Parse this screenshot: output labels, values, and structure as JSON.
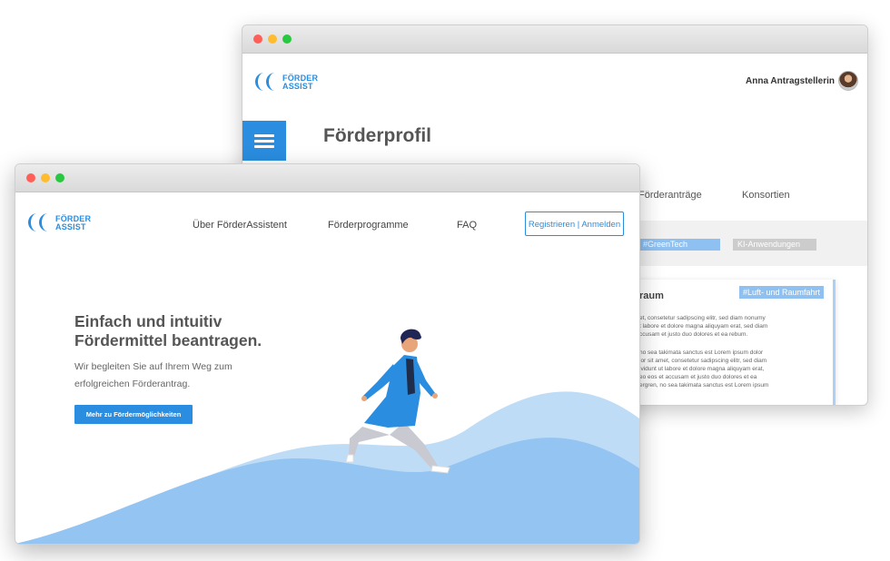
{
  "back_window": {
    "logo": {
      "line1": "FÖRDER",
      "line2": "ASSIST"
    },
    "user_name": "Anna Antragstellerin",
    "page_title": "Förderprofil",
    "tabs": [
      "Förderanträge",
      "Konsortien"
    ],
    "tags": [
      {
        "label": "#GreenTech",
        "color": "#8ec1f2"
      },
      {
        "label": "KI-Anwendungen",
        "color": "#cccccc"
      }
    ],
    "card": {
      "title": "raum",
      "tag": "#Luft- und Raumfahrt",
      "paragraph1": "et, consetetur sadipscing elitr, sed diam nonumy\nt labore et dolore magna aliquyam erat, sed diam\nccusam et justo duo dolores et ea rebum.",
      "paragraph2": "no sea takimata sanctus est Lorem ipsum dolor\nlor sit amet, consetetur sadipscing elitr, sed diam\nividunt ut labore et dolore magna aliquyam erat,\neo eos et accusam et justo duo dolores et ea\nergren, no sea takimata sanctus est Lorem ipsum"
    }
  },
  "front_window": {
    "logo": {
      "line1": "FÖRDER",
      "line2": "ASSIST"
    },
    "nav": [
      "Über FörderAssistent",
      "Förderprogramme",
      "FAQ"
    ],
    "register_button": "Registrieren | Anmelden",
    "hero": {
      "headline_line1": "Einfach und intuitiv",
      "headline_line2": "Fördermittel beantragen.",
      "subtext_line1": "Wir begleiten Sie auf Ihrem Weg zum",
      "subtext_line2": "erfolgreichen Förderantrag.",
      "cta": "Mehr zu Fördermöglichkeiten"
    }
  },
  "colors": {
    "accent": "#2a8de0",
    "wave_light": "#bfdcf7",
    "wave_dark": "#94c4f2"
  }
}
